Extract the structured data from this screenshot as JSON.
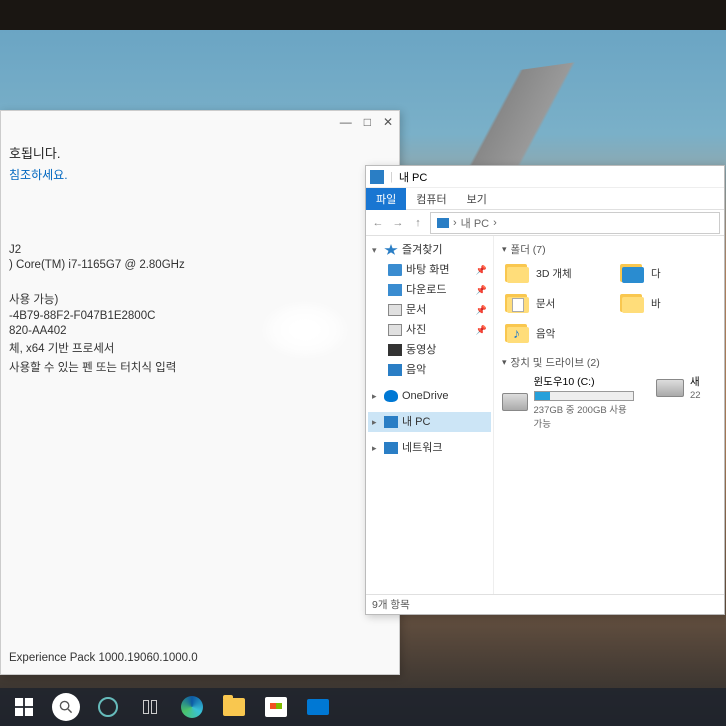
{
  "settings": {
    "heading": "호됩니다.",
    "link": "침조하세요.",
    "lines": {
      "l1": "J2",
      "l2": ") Core(TM) i7-1165G7 @ 2.80GHz",
      "l3": "사용 가능)",
      "l4": "-4B79-88F2-F047B1E2800C",
      "l5": "820-AA402",
      "l6": "체, x64 기반 프로세서",
      "l7": "사용할 수 있는 펜 또는 터치식 입력"
    },
    "footer": "Experience Pack 1000.19060.1000.0",
    "chrome": {
      "min": "—",
      "max": "□",
      "close": "✕"
    }
  },
  "explorer": {
    "title": "내 PC",
    "tabs": {
      "file": "파일",
      "computer": "컴퓨터",
      "view": "보기"
    },
    "addr": {
      "nav_back": "←",
      "nav_fwd": "→",
      "nav_up": "↑",
      "path": "내 PC",
      "sep": "›"
    },
    "nav": {
      "quick": "즐겨찾기",
      "desktop": "바탕 화면",
      "downloads": "다운로드",
      "documents": "문서",
      "pictures": "사진",
      "videos": "동영상",
      "music": "음악",
      "onedrive": "OneDrive",
      "thispc": "내 PC",
      "network": "네트워크"
    },
    "groups": {
      "folders": "폴더 (7)",
      "drives": "장치 및 드라이브 (2)"
    },
    "folders": {
      "f3d": "3D 개체",
      "downloads": "다",
      "documents": "문서",
      "desktop": "바",
      "music": "음악"
    },
    "drives": {
      "c_name": "윈도우10 (C:)",
      "c_free": "237GB 중 200GB 사용 가능",
      "d_name": "새",
      "d_free": "22"
    },
    "status": "9개 항목"
  }
}
